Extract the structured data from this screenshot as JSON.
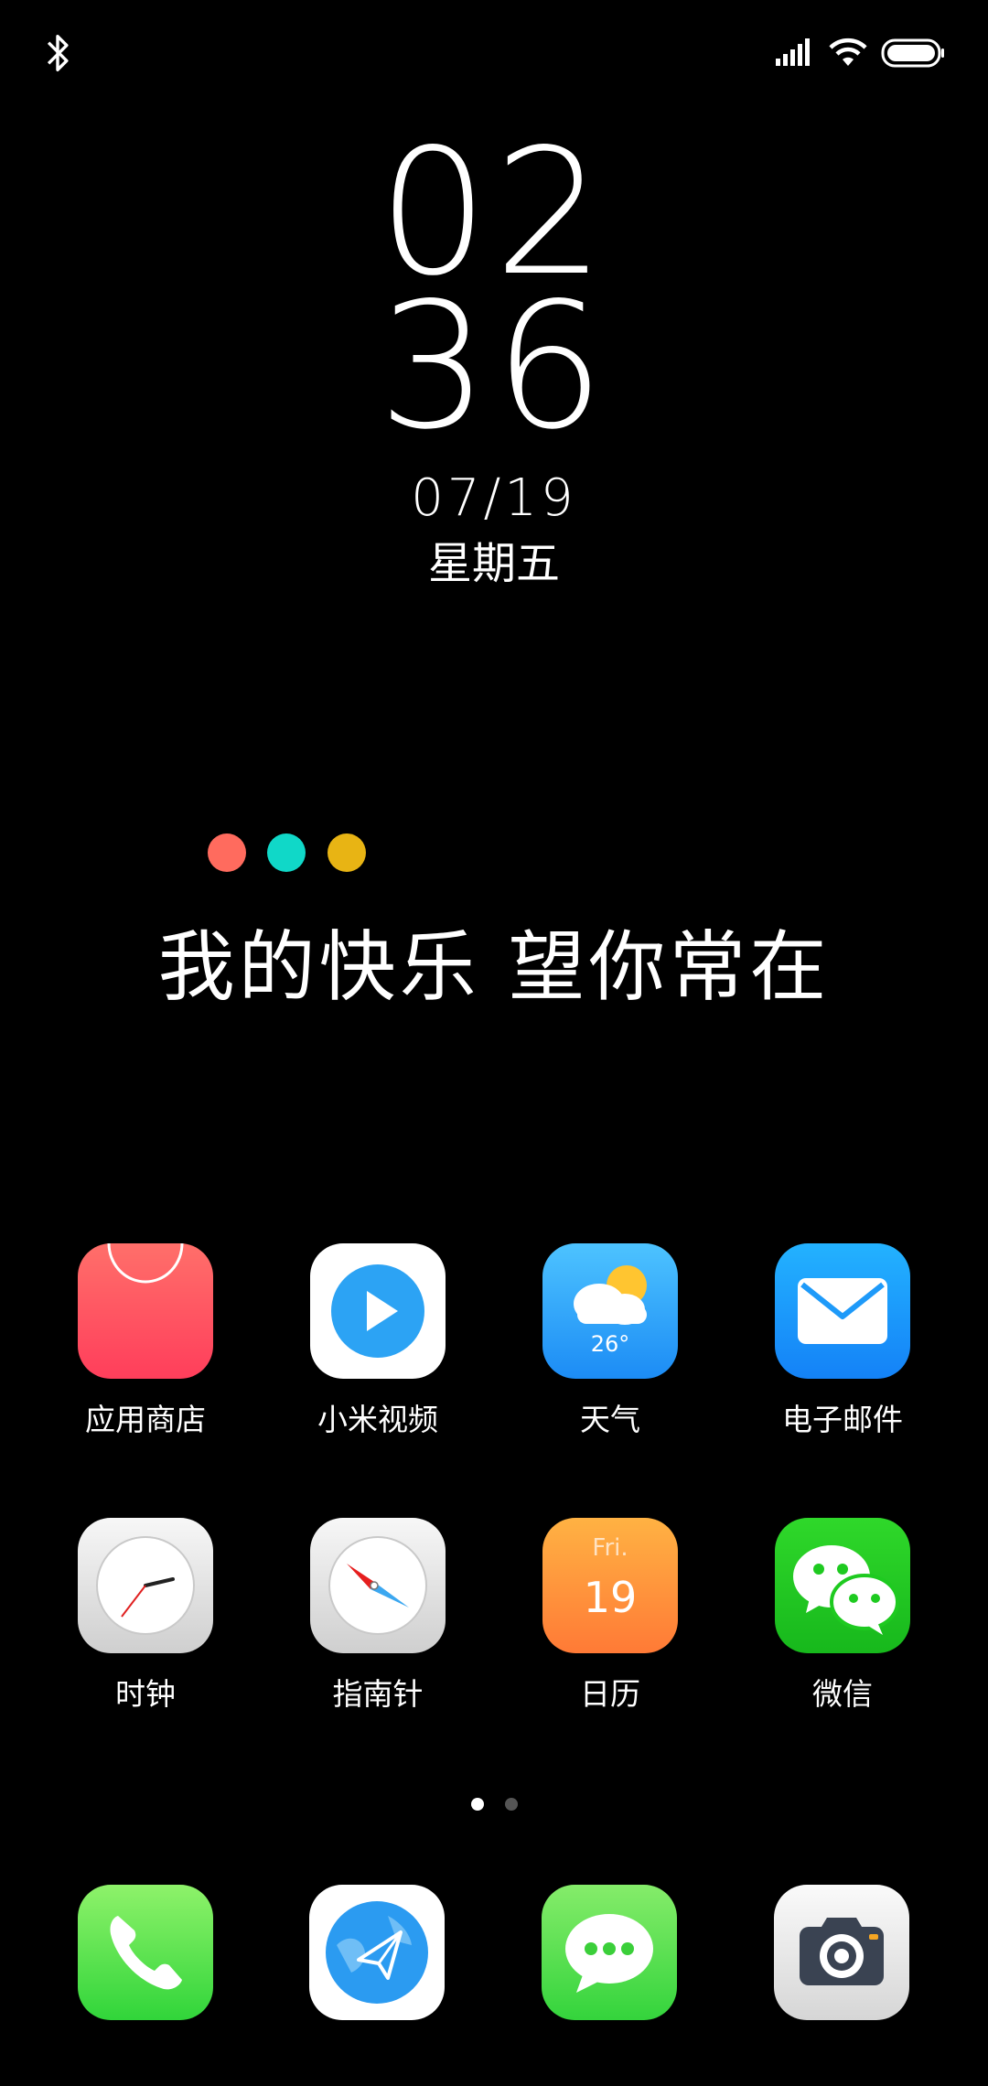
{
  "status_bar": {
    "bluetooth_icon": "bluetooth-icon",
    "signal_icon": "cellular-signal-icon",
    "wifi_icon": "wifi-icon",
    "battery_icon": "battery-icon"
  },
  "clock": {
    "hour": "02",
    "minute": "36",
    "date": "07/19",
    "weekday": "星期五"
  },
  "slogan": {
    "text": "我的快乐 望你常在",
    "dot_colors": [
      "#FF6B5E",
      "#10D8C8",
      "#E8B414"
    ]
  },
  "apps": [
    {
      "label": "应用商店"
    },
    {
      "label": "小米视频"
    },
    {
      "label": "天气",
      "temperature": "26°"
    },
    {
      "label": "电子邮件"
    },
    {
      "label": "时钟"
    },
    {
      "label": "指南针"
    },
    {
      "label": "日历",
      "day_name": "Fri.",
      "day_number": "19"
    },
    {
      "label": "微信"
    }
  ],
  "page_indicator": {
    "current": 1,
    "total": 2
  },
  "dock": [
    "phone-icon",
    "browser-icon",
    "messages-icon",
    "camera-icon"
  ]
}
